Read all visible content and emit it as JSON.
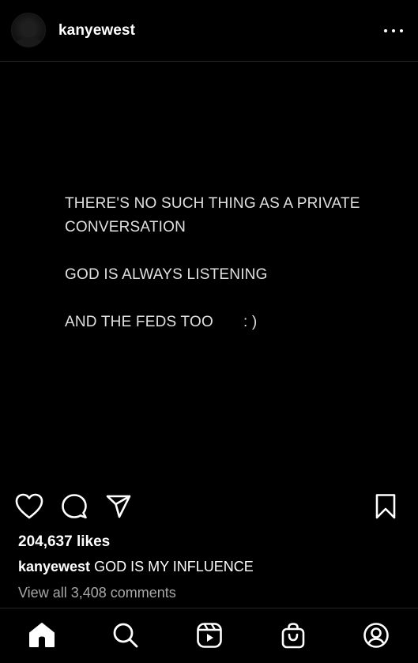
{
  "header": {
    "username": "kanyewest",
    "avatar_icon": "profile-photo",
    "more_icon": "more-options-icon"
  },
  "post": {
    "lines": [
      "THERE'S NO SUCH THING AS A PRIVATE",
      "CONVERSATION",
      "GOD IS ALWAYS LISTENING",
      "AND THE FEDS TOO"
    ],
    "smiley": ": )"
  },
  "actions": {
    "icons": [
      "heart-icon",
      "comment-icon",
      "share-icon",
      "bookmark-icon"
    ]
  },
  "likes": "204,637 likes",
  "caption": {
    "username": "kanyewest",
    "text": "GOD IS MY INFLUENCE"
  },
  "comments_link": "View all 3,408 comments",
  "nav": {
    "icons": [
      "home-icon",
      "search-icon",
      "reels-icon",
      "shop-icon",
      "profile-icon"
    ],
    "active": "home-icon"
  },
  "colors": {
    "background": "#000000",
    "text": "#ffffff",
    "muted": "#a8a8a8",
    "divider": "#262626"
  }
}
